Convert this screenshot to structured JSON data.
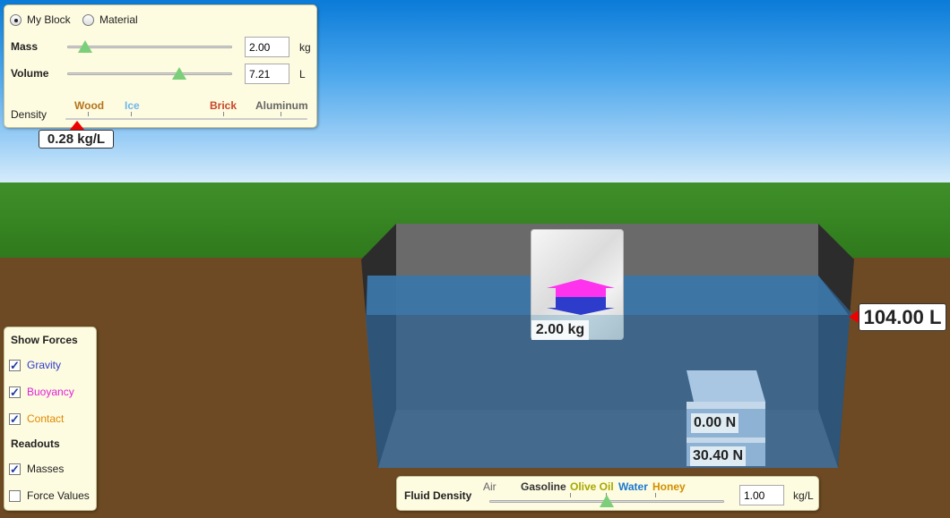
{
  "block_controls": {
    "mode_my_block": "My Block",
    "mode_material": "Material",
    "mass": {
      "label": "Mass",
      "value": "2.00",
      "unit": "kg",
      "fraction": 0.11
    },
    "volume": {
      "label": "Volume",
      "value": "7.21",
      "unit": "L",
      "fraction": 0.68
    },
    "density": {
      "label": "Density",
      "materials": [
        {
          "name": "Wood",
          "color": "#b5741d"
        },
        {
          "name": "Ice",
          "color": "#6fb6ee"
        },
        {
          "name": "Brick",
          "color": "#c8472a"
        },
        {
          "name": "Aluminum",
          "color": "#666666"
        }
      ],
      "readout": "0.28 kg/L"
    }
  },
  "pool": {
    "volume_readout": "104.00 L",
    "block_mass_label": "2.00 kg",
    "scale_readings": [
      "0.00 N",
      "30.40 N"
    ]
  },
  "show_forces": {
    "title": "Show Forces",
    "items": [
      {
        "label": "Gravity",
        "checked": true,
        "color": "#2e3ccc"
      },
      {
        "label": "Buoyancy",
        "checked": true,
        "color": "#e020d8"
      },
      {
        "label": "Contact",
        "checked": true,
        "color": "#e08a00"
      }
    ]
  },
  "readouts": {
    "title": "Readouts",
    "items": [
      {
        "label": "Masses",
        "checked": true
      },
      {
        "label": "Force Values",
        "checked": false
      }
    ]
  },
  "fluid_density": {
    "label": "Fluid Density",
    "materials": [
      {
        "name": "Air",
        "color": "#666666"
      },
      {
        "name": "Gasoline",
        "color": "#333333"
      },
      {
        "name": "Olive Oil",
        "color": "#a8a800"
      },
      {
        "name": "Water",
        "color": "#1b78d0"
      },
      {
        "name": "Honey",
        "color": "#d28f00"
      }
    ],
    "value": "1.00",
    "unit": "kg/L"
  },
  "colors": {
    "gravity": "#2e3ccc",
    "buoyancy": "#ff33ee",
    "water": "#2a6aa0"
  }
}
